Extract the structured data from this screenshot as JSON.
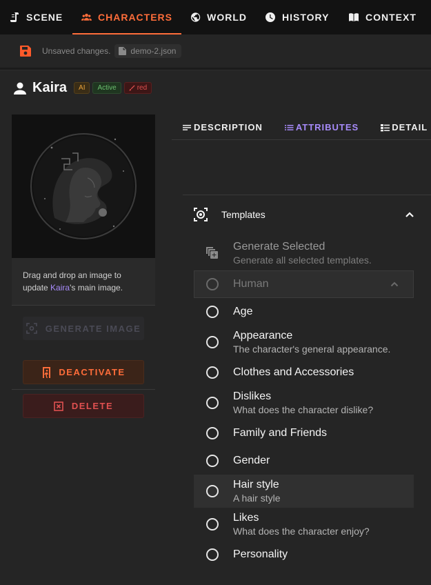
{
  "nav": {
    "items": [
      {
        "label": "SCENE",
        "icon": "scroll-icon"
      },
      {
        "label": "CHARACTERS",
        "icon": "group-icon"
      },
      {
        "label": "WORLD",
        "icon": "globe-icon"
      },
      {
        "label": "HISTORY",
        "icon": "clock-icon"
      },
      {
        "label": "CONTEXT",
        "icon": "book-icon"
      }
    ],
    "active": "CHARACTERS",
    "accent": "#ff6d3a"
  },
  "status": {
    "unsaved_text": "Unsaved changes.",
    "filename": "demo-2.json"
  },
  "character": {
    "name": "Kaira",
    "chips": {
      "ai": "AI",
      "active": "Active",
      "color": "red"
    },
    "drop_note_prefix": "Drag and drop an image to update ",
    "drop_note_name": "Kaira",
    "drop_note_suffix": "'s main image."
  },
  "actions": {
    "generate_image": "GENERATE IMAGE",
    "deactivate": "DEACTIVATE",
    "delete": "DELETE"
  },
  "tabs": {
    "description": "DESCRIPTION",
    "attributes": "ATTRIBUTES",
    "details": "DETAIL",
    "active": "ATTRIBUTES",
    "accent": "#a78bfa"
  },
  "templates": {
    "title": "Templates",
    "generate_selected": {
      "title": "Generate Selected",
      "subtitle": "Generate all selected templates."
    },
    "group_select": {
      "value": "Human"
    },
    "items": [
      {
        "title": "Age",
        "subtitle": ""
      },
      {
        "title": "Appearance",
        "subtitle": "The character's general appearance."
      },
      {
        "title": "Clothes and Accessories",
        "subtitle": ""
      },
      {
        "title": "Dislikes",
        "subtitle": "What does the character dislike?"
      },
      {
        "title": "Family and Friends",
        "subtitle": ""
      },
      {
        "title": "Gender",
        "subtitle": ""
      },
      {
        "title": "Hair style",
        "subtitle": "A hair style"
      },
      {
        "title": "Likes",
        "subtitle": "What does the character enjoy?"
      },
      {
        "title": "Personality",
        "subtitle": ""
      }
    ]
  }
}
